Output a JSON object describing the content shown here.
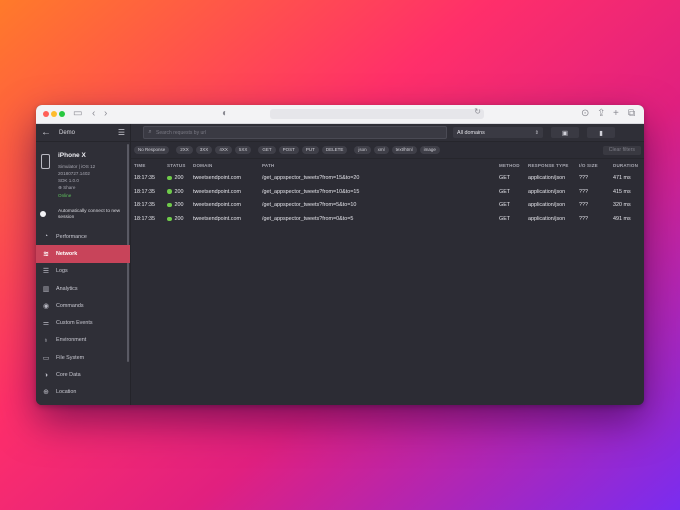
{
  "app": {
    "title": "Demo"
  },
  "device": {
    "name": "iPhone X",
    "simulator": "Simulator | iOS 12",
    "build": "20180727.1402",
    "sdk": "SDK 1.0.0",
    "share": "⊕ Share",
    "status": "Online"
  },
  "sidebar": {
    "auto_connect": "Automatically connect to new session",
    "items": [
      {
        "label": "Performance"
      },
      {
        "label": "Network"
      },
      {
        "label": "Logs"
      },
      {
        "label": "Analytics"
      },
      {
        "label": "Commands"
      },
      {
        "label": "Custom Events"
      },
      {
        "label": "Environment"
      },
      {
        "label": "File System"
      },
      {
        "label": "Core Data"
      },
      {
        "label": "Location"
      }
    ]
  },
  "toolbar": {
    "search_placeholder": "Search requests by url",
    "domain_select": "All domains"
  },
  "filters": {
    "chips": [
      "No Response",
      "2XX",
      "3XX",
      "4XX",
      "5XX",
      "GET",
      "POST",
      "PUT",
      "DELETE",
      "json",
      "xml",
      "text/html",
      "image"
    ],
    "clear_label": "Clear filters"
  },
  "table": {
    "columns": [
      "TIME",
      "STATUS",
      "DOMAIN",
      "PATH",
      "METHOD",
      "RESPONSE TYPE",
      "I/O SIZE",
      "DURATION"
    ],
    "rows": [
      {
        "time": "18:17:35",
        "status": "200",
        "domain": "tweetsendpoint.com",
        "path": "/get_appspector_tweets?from=15&to=20",
        "method": "GET",
        "rtype": "application/json",
        "io": "???",
        "duration": "471 ms"
      },
      {
        "time": "18:17:35",
        "status": "200",
        "domain": "tweetsendpoint.com",
        "path": "/get_appspector_tweets?from=10&to=15",
        "method": "GET",
        "rtype": "application/json",
        "io": "???",
        "duration": "415 ms"
      },
      {
        "time": "18:17:35",
        "status": "200",
        "domain": "tweetsendpoint.com",
        "path": "/get_appspector_tweets?from=5&to=10",
        "method": "GET",
        "rtype": "application/json",
        "io": "???",
        "duration": "320 ms"
      },
      {
        "time": "18:17:35",
        "status": "200",
        "domain": "tweetsendpoint.com",
        "path": "/get_appspector_tweets?from=0&to=5",
        "method": "GET",
        "rtype": "application/json",
        "io": "???",
        "duration": "491 ms"
      }
    ]
  },
  "colors": {
    "accent": "#c8445a",
    "success": "#6fcb4a",
    "online": "#5ec35e"
  }
}
